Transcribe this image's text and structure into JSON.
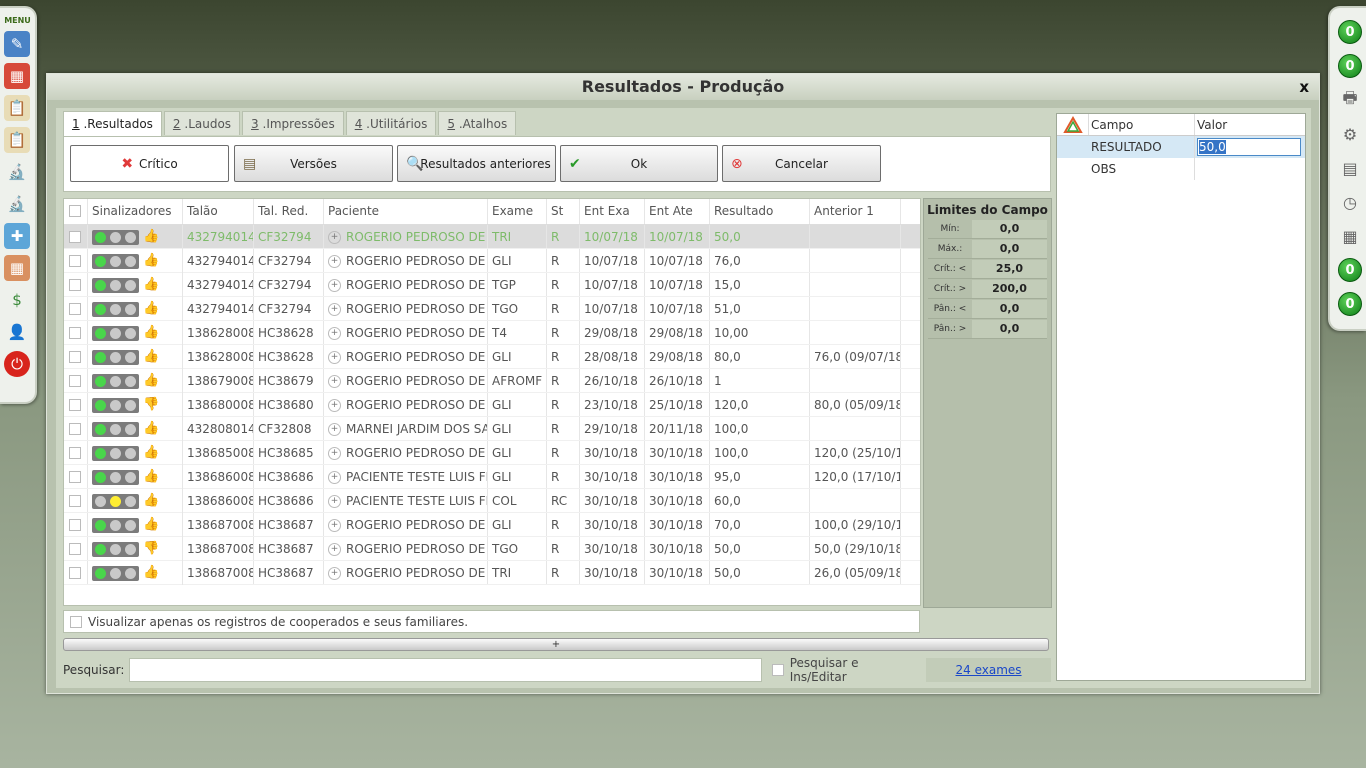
{
  "left_menu": {
    "label": "MENU",
    "icons": [
      "edit-icon",
      "calendar-icon",
      "clipboard-icon",
      "clipboard-list-icon",
      "microscope-icon",
      "microscope-2-icon",
      "medicine-box-icon",
      "calendar-grid-icon",
      "money-icon",
      "user-icon",
      "power-icon"
    ]
  },
  "right_bar": {
    "badge_top_1": "0",
    "badge_top_2": "0",
    "badge_bottom_1": "0",
    "badge_bottom_2": "0"
  },
  "window": {
    "title": "Resultados - Produção",
    "close": "x"
  },
  "tabs": [
    {
      "num": "1",
      "label": " .Resultados"
    },
    {
      "num": "2",
      "label": " .Laudos"
    },
    {
      "num": "3",
      "label": " .Impressões"
    },
    {
      "num": "4",
      "label": " .Utilitários"
    },
    {
      "num": "5",
      "label": " .Atalhos"
    }
  ],
  "toolbar": {
    "critico": "Crítico",
    "versoes": "Versões",
    "resultados_anteriores": "Resultados anteriores",
    "ok": "Ok",
    "cancelar": "Cancelar"
  },
  "grid": {
    "columns": [
      "Sinalizadores",
      "Talão",
      "Tal. Red.",
      "Paciente",
      "Exame",
      "St",
      "Ent Exa",
      "Ent Ate",
      "Resultado",
      "Anterior 1"
    ],
    "rows": [
      {
        "lights": "ggg",
        "thumb": "up",
        "talao": "432794014",
        "talred": "CF32794",
        "paciente": "ROGERIO PEDROSO DE F",
        "exame": "TRI",
        "st": "R",
        "entexa": "10/07/18",
        "entate": "10/07/18",
        "resultado": "50,0",
        "anterior": ""
      },
      {
        "lights": "g",
        "thumb": "up",
        "talao": "432794014",
        "talred": "CF32794",
        "paciente": "ROGERIO PEDROSO DE F",
        "exame": "GLI",
        "st": "R",
        "entexa": "10/07/18",
        "entate": "10/07/18",
        "resultado": "76,0",
        "anterior": ""
      },
      {
        "lights": "g",
        "thumb": "up",
        "talao": "432794014",
        "talred": "CF32794",
        "paciente": "ROGERIO PEDROSO DE F",
        "exame": "TGP",
        "st": "R",
        "entexa": "10/07/18",
        "entate": "10/07/18",
        "resultado": "15,0",
        "anterior": ""
      },
      {
        "lights": "g",
        "thumb": "up",
        "talao": "432794014",
        "talred": "CF32794",
        "paciente": "ROGERIO PEDROSO DE F",
        "exame": "TGO",
        "st": "R",
        "entexa": "10/07/18",
        "entate": "10/07/18",
        "resultado": "51,0",
        "anterior": ""
      },
      {
        "lights": "g",
        "thumb": "up",
        "talao": "138628008",
        "talred": "HC38628",
        "paciente": "ROGERIO PEDROSO DE F",
        "exame": "T4",
        "st": "R",
        "entexa": "29/08/18",
        "entate": "29/08/18",
        "resultado": "10,00",
        "anterior": ""
      },
      {
        "lights": "g",
        "thumb": "up",
        "talao": "138628008",
        "talred": "HC38628",
        "paciente": "ROGERIO PEDROSO DE F",
        "exame": "GLI",
        "st": "R",
        "entexa": "28/08/18",
        "entate": "29/08/18",
        "resultado": "80,0",
        "anterior": "76,0 (09/07/18"
      },
      {
        "lights": "g",
        "thumb": "up",
        "talao": "138679008",
        "talred": "HC38679",
        "paciente": "ROGERIO PEDROSO DE F",
        "exame": "AFROMF",
        "st": "R",
        "entexa": "26/10/18",
        "entate": "26/10/18",
        "resultado": "1",
        "anterior": ""
      },
      {
        "lights": "g",
        "thumb": "down",
        "talao": "138680008",
        "talred": "HC38680",
        "paciente": "ROGERIO PEDROSO DE F",
        "exame": "GLI",
        "st": "R",
        "entexa": "23/10/18",
        "entate": "25/10/18",
        "resultado": "120,0",
        "anterior": "80,0 (05/09/18"
      },
      {
        "lights": "g",
        "thumb": "up",
        "talao": "432808014",
        "talred": "CF32808",
        "paciente": "MARNEI JARDIM DOS SA",
        "exame": "GLI",
        "st": "R",
        "entexa": "29/10/18",
        "entate": "20/11/18",
        "resultado": "100,0",
        "anterior": ""
      },
      {
        "lights": "g",
        "thumb": "up",
        "talao": "138685008",
        "talred": "HC38685",
        "paciente": "ROGERIO PEDROSO DE F",
        "exame": "GLI",
        "st": "R",
        "entexa": "30/10/18",
        "entate": "30/10/18",
        "resultado": "100,0",
        "anterior": "120,0 (25/10/1"
      },
      {
        "lights": "g",
        "thumb": "up",
        "talao": "138686008",
        "talred": "HC38686",
        "paciente": "PACIENTE TESTE LUIS FE",
        "exame": "GLI",
        "st": "R",
        "entexa": "30/10/18",
        "entate": "30/10/18",
        "resultado": "95,0",
        "anterior": "120,0 (17/10/1"
      },
      {
        "lights": "y",
        "thumb": "up",
        "talao": "138686008",
        "talred": "HC38686",
        "paciente": "PACIENTE TESTE LUIS FE",
        "exame": "COL",
        "st": "RC",
        "entexa": "30/10/18",
        "entate": "30/10/18",
        "resultado": "60,0",
        "anterior": ""
      },
      {
        "lights": "g",
        "thumb": "up",
        "talao": "138687008",
        "talred": "HC38687",
        "paciente": "ROGERIO PEDROSO DE F",
        "exame": "GLI",
        "st": "R",
        "entexa": "30/10/18",
        "entate": "30/10/18",
        "resultado": "70,0",
        "anterior": "100,0 (29/10/1"
      },
      {
        "lights": "g",
        "thumb": "down",
        "talao": "138687008",
        "talred": "HC38687",
        "paciente": "ROGERIO PEDROSO DE F",
        "exame": "TGO",
        "st": "R",
        "entexa": "30/10/18",
        "entate": "30/10/18",
        "resultado": "50,0",
        "anterior": "50,0 (29/10/18"
      },
      {
        "lights": "g",
        "thumb": "up",
        "talao": "138687008",
        "talred": "HC38687",
        "paciente": "ROGERIO PEDROSO DE F",
        "exame": "TRI",
        "st": "R",
        "entexa": "30/10/18",
        "entate": "30/10/18",
        "resultado": "50,0",
        "anterior": "26,0 (05/09/18"
      }
    ]
  },
  "limits": {
    "title": "Limites do Campo",
    "rows": [
      {
        "label": "Mín:",
        "value": "0,0"
      },
      {
        "label": "Máx.:",
        "value": "0,0"
      },
      {
        "label": "Crít.: <",
        "value": "25,0"
      },
      {
        "label": "Crít.: >",
        "value": "200,0"
      },
      {
        "label": "Pân.: <",
        "value": "0,0"
      },
      {
        "label": "Pân.: >",
        "value": "0,0"
      }
    ]
  },
  "filter": {
    "label": "Visualizar apenas os registros de cooperados e seus familiares."
  },
  "expander": "+",
  "search": {
    "label": "Pesquisar:",
    "value": "",
    "checkbox_label": "Pesquisar e Ins/Editar",
    "exams_count": "24 exames"
  },
  "field_panel": {
    "col_campo": "Campo",
    "col_valor": "Valor",
    "rows": [
      {
        "campo": "RESULTADO",
        "valor": "50,0"
      },
      {
        "campo": "OBS",
        "valor": ""
      }
    ]
  }
}
